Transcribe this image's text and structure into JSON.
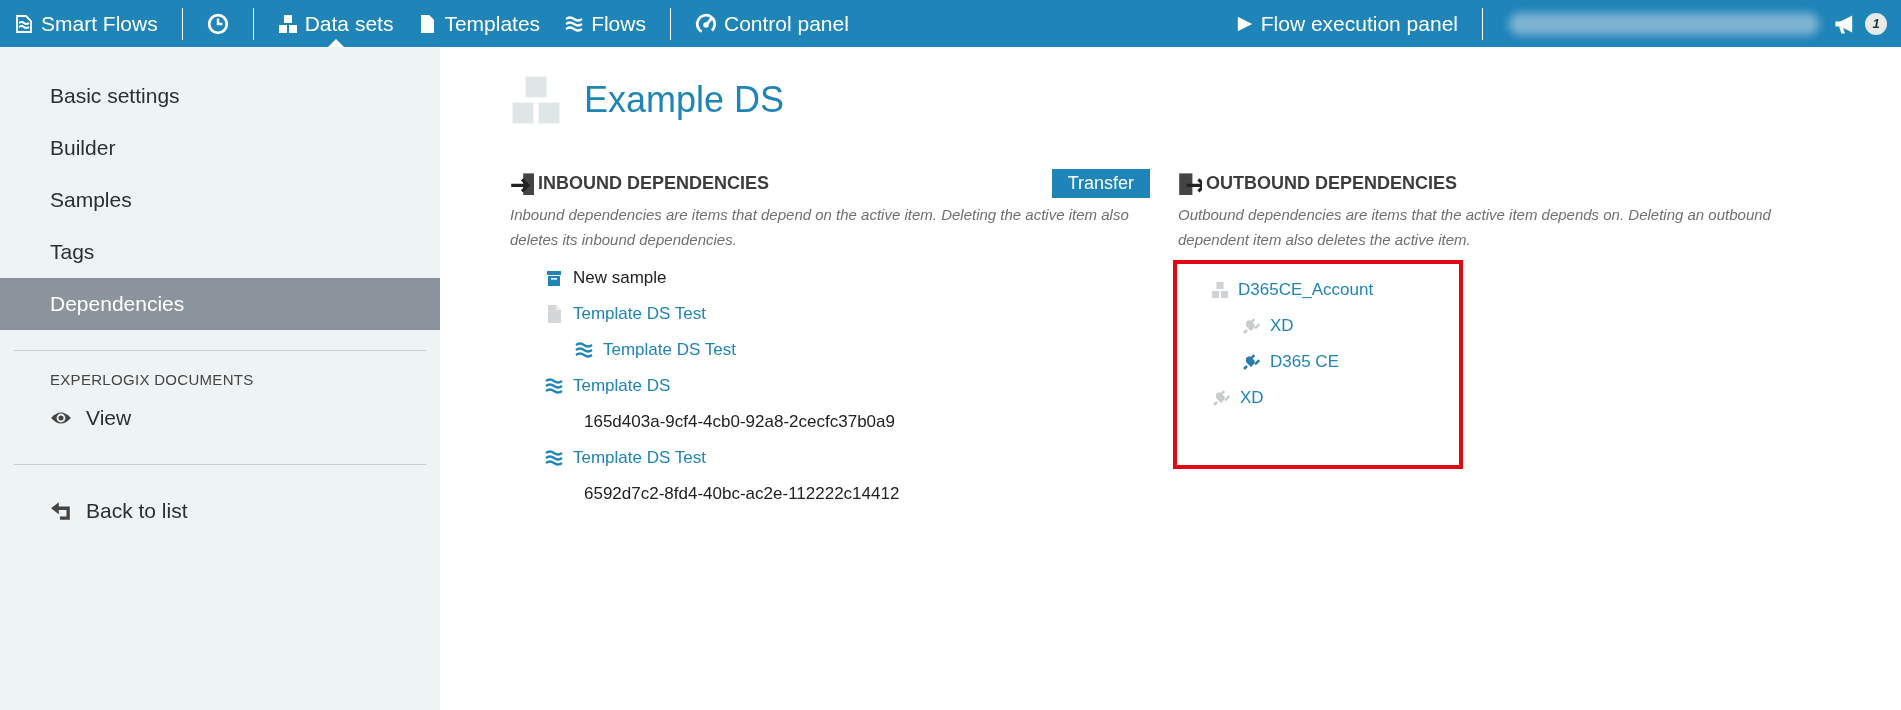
{
  "topbar": {
    "brand": "Smart Flows",
    "nav": [
      {
        "kind": "history",
        "selected": false
      },
      {
        "kind": "datasets",
        "label": "Data sets",
        "selected": true
      },
      {
        "kind": "templates",
        "label": "Templates",
        "selected": false
      },
      {
        "kind": "flows",
        "label": "Flows",
        "selected": false
      },
      {
        "kind": "control",
        "label": "Control panel",
        "selected": false
      }
    ],
    "execution": "Flow execution panel",
    "notification_count": "1"
  },
  "sidebar": {
    "items": [
      {
        "label": "Basic settings",
        "selected": false
      },
      {
        "label": "Builder",
        "selected": false
      },
      {
        "label": "Samples",
        "selected": false
      },
      {
        "label": "Tags",
        "selected": false
      },
      {
        "label": "Dependencies",
        "selected": true
      }
    ],
    "section_title": "EXPERLOGIX DOCUMENTS",
    "section_items": [
      {
        "kind": "view",
        "label": "View"
      }
    ],
    "back": "Back to list"
  },
  "title": "Example DS",
  "inbound": {
    "heading": "INBOUND DEPENDENCIES",
    "button": "Transfer",
    "description": "Inbound dependencies are items that depend on the active item. Deleting the active item also deletes its inbound dependencies.",
    "items": [
      {
        "kind": "sample",
        "label": "New sample"
      },
      {
        "kind": "template",
        "label": "Template DS Test",
        "children": [
          {
            "kind": "flow",
            "label": "Template DS Test"
          }
        ]
      },
      {
        "kind": "flow",
        "label": "Template DS",
        "children": [
          {
            "kind": "text",
            "label": "165d403a-9cf4-4cb0-92a8-2cecfc37b0a9"
          }
        ]
      },
      {
        "kind": "flow",
        "label": "Template DS Test",
        "children": [
          {
            "kind": "text",
            "label": "6592d7c2-8fd4-40bc-ac2e-112222c14412"
          }
        ]
      }
    ]
  },
  "outbound": {
    "heading": "OUTBOUND DEPENDENCIES",
    "description": "Outbound dependencies are items that the active item depends on. Deleting an outbound dependent item also deletes the active item.",
    "items": [
      {
        "kind": "dataset",
        "label": "D365CE_Account",
        "children": [
          {
            "kind": "connector",
            "label": "XD",
            "active": false
          },
          {
            "kind": "connector",
            "label": "D365 CE",
            "active": true
          }
        ]
      },
      {
        "kind": "connector",
        "label": "XD",
        "active": false
      }
    ]
  }
}
